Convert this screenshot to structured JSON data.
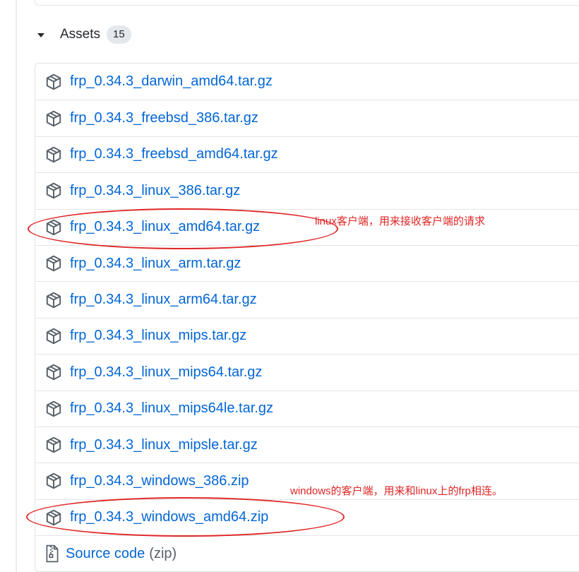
{
  "assets": {
    "title": "Assets",
    "count": "15",
    "files": [
      "frp_0.34.3_darwin_amd64.tar.gz",
      "frp_0.34.3_freebsd_386.tar.gz",
      "frp_0.34.3_freebsd_amd64.tar.gz",
      "frp_0.34.3_linux_386.tar.gz",
      "frp_0.34.3_linux_amd64.tar.gz",
      "frp_0.34.3_linux_arm.tar.gz",
      "frp_0.34.3_linux_arm64.tar.gz",
      "frp_0.34.3_linux_mips.tar.gz",
      "frp_0.34.3_linux_mips64.tar.gz",
      "frp_0.34.3_linux_mips64le.tar.gz",
      "frp_0.34.3_linux_mipsle.tar.gz",
      "frp_0.34.3_windows_386.zip",
      "frp_0.34.3_windows_amd64.zip"
    ],
    "source": {
      "label": "Source code",
      "suffix": "(zip)"
    }
  },
  "annotations": {
    "linux_note": "linux客户端，用来接收客户端的请求",
    "windows_note": "windows的客户端，用来和linux上的frp相连。"
  },
  "colors": {
    "link": "#0366d6",
    "annotation": "#e02525",
    "border": "#e1e4e8"
  },
  "icons": {
    "asset": "package-icon",
    "source": "file-zip-icon",
    "toggle": "triangle-down-icon"
  }
}
